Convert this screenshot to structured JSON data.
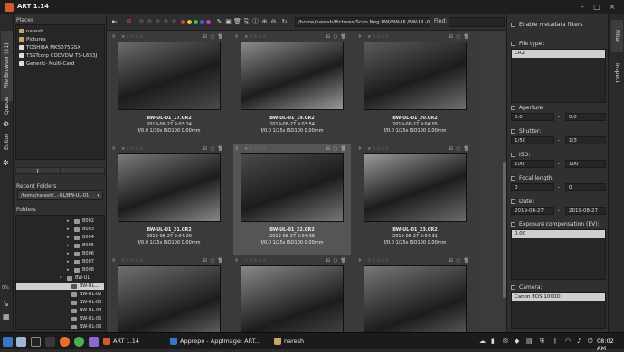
{
  "window": {
    "title": "ART 1.14"
  },
  "left_tabs": [
    "File Browser (21)",
    "Queue",
    "Editor"
  ],
  "zoom_percent": "0%",
  "places": {
    "title": "Places",
    "items": [
      {
        "label": "naresh",
        "icon": "home-icon"
      },
      {
        "label": "Pictures",
        "icon": "folder-icon"
      },
      {
        "label": "TOSHIBA MK5075GSX",
        "icon": "drive-icon"
      },
      {
        "label": "TSSTcorp CDDVDW TS-L633J",
        "icon": "optical-drive-icon"
      },
      {
        "label": "Generic- Multi-Card",
        "icon": "drive-icon"
      }
    ],
    "add_label": "+",
    "remove_label": "−"
  },
  "recent_folders": {
    "title": "Recent Folders",
    "value": "/home/naresh/...-UL/BW-UL-01"
  },
  "folders": {
    "title": "Folders",
    "items": [
      "B002",
      "B003",
      "B004",
      "B005",
      "B006",
      "B007",
      "B008",
      "BW-UL",
      "BW-UL...",
      "BW-UL-02",
      "BW-UL-03",
      "BW-UL-04",
      "BW-UL-05",
      "BW-UL-06"
    ]
  },
  "toolbar": {
    "path": "/home/naresh/Pictures/Scan Neg BW/BW-UL/BW-UL-01",
    "find_label": "Find:",
    "find_value": "",
    "color_labels": [
      "#e04040",
      "#e0c040",
      "#40c040",
      "#4060e0",
      "#c040c0"
    ]
  },
  "thumbnails": [
    {
      "name": "BW-UL-01_17.CR2",
      "date": "2019-08-27 9:03:24",
      "exif": "f/0.0 1/30s ISO100 0.00mm",
      "rating": 1,
      "selected": false
    },
    {
      "name": "BW-UL-01_19.CR2",
      "date": "2019-08-27 9:03:54",
      "exif": "f/0.0 1/25s ISO100 0.00mm",
      "rating": 1,
      "selected": false
    },
    {
      "name": "BW-UL-01_20.CR2",
      "date": "2019-08-27 9:04:05",
      "exif": "f/0.0 1/25s ISO100 0.00mm",
      "rating": 1,
      "selected": false
    },
    {
      "name": "BW-UL-01_21.CR2",
      "date": "2019-08-27 9:04:29",
      "exif": "f/0.0 1/25s ISO100 0.00mm",
      "rating": 1,
      "selected": false
    },
    {
      "name": "BW-UL-01_22.CR2",
      "date": "2019-08-27 9:04:38",
      "exif": "f/0.0 1/25s ISO100 0.00mm",
      "rating": 1,
      "selected": true
    },
    {
      "name": "BW-UL-01_23.CR2",
      "date": "2019-08-27 9:04:31",
      "exif": "f/0.0 1/25s ISO100 0.00mm",
      "rating": 1,
      "selected": false
    },
    {
      "name": "",
      "date": "",
      "exif": "",
      "rating": 0,
      "selected": false
    },
    {
      "name": "",
      "date": "",
      "exif": "",
      "rating": 0,
      "selected": false
    },
    {
      "name": "",
      "date": "",
      "exif": "",
      "rating": 0,
      "selected": false
    }
  ],
  "filter_panel": {
    "enable_label": "Enable metadata filters",
    "file_type_label": "File type:",
    "file_type_value": "CR2",
    "aperture_label": "Aperture:",
    "aperture_from": "0.0",
    "aperture_to": "0.0",
    "shutter_label": "Shutter:",
    "shutter_from": "1/50",
    "shutter_to": "1/3",
    "iso_label": "ISO:",
    "iso_from": "100",
    "iso_to": "100",
    "focal_label": "Focal length:",
    "focal_from": "0",
    "focal_to": "0",
    "date_label": "Date:",
    "date_from": "2019-08-27",
    "date_to": "2019-08-27",
    "expcomp_label": "Exposure compensation (EV):",
    "expcomp_value": "0.00",
    "camera_label": "Camera:",
    "camera_value": "Canon EOS 1000D",
    "range_separator": "-"
  },
  "right_tabs": [
    "Filter",
    "Inspect"
  ],
  "taskbar": {
    "art_label": "ART 1.14",
    "apprepo_label": "Apprepo - AppImage: ART...",
    "naresh_label": "naresh",
    "clock": "08:02 AM"
  }
}
